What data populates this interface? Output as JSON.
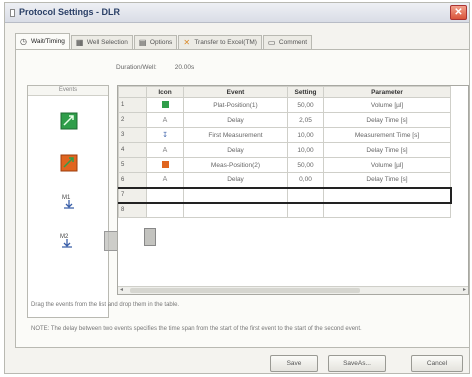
{
  "window": {
    "title": "Protocol Settings - DLR",
    "close_glyph": "✕"
  },
  "tabs": [
    {
      "label": "Wait/Timing",
      "icon": "clock-icon"
    },
    {
      "label": "Well Selection",
      "icon": "plate-icon"
    },
    {
      "label": "Options",
      "icon": "options-icon"
    },
    {
      "label": "Transfer to Excel(TM)",
      "icon": "excel-icon"
    },
    {
      "label": "Comment",
      "icon": "comment-icon"
    }
  ],
  "duration": {
    "label": "Duration/Well:",
    "value": "20.00s"
  },
  "palette": {
    "title": "Events",
    "items": [
      "move-position-green-icon",
      "move-position-orange-icon",
      "measurement-m1-icon",
      "measurement-m2-icon"
    ]
  },
  "grid": {
    "columns": [
      "Icon",
      "Event",
      "Setting",
      "Parameter"
    ],
    "rows": [
      {
        "num": "1",
        "icon": "green-square",
        "event": "Plat-Position(1)",
        "setting": "50,00",
        "parameter": "Volume [µl]"
      },
      {
        "num": "2",
        "icon": "delay-glyph",
        "event": "Delay",
        "setting": "2,05",
        "parameter": "Delay Time [s]"
      },
      {
        "num": "3",
        "icon": "measure-glyph",
        "event": "First Measurement",
        "setting": "10,00",
        "parameter": "Measurement Time [s]"
      },
      {
        "num": "4",
        "icon": "delay-glyph",
        "event": "Delay",
        "setting": "10,00",
        "parameter": "Delay Time [s]"
      },
      {
        "num": "5",
        "icon": "orange-square",
        "event": "Meas-Position(2)",
        "setting": "50,00",
        "parameter": "Volume [µl]"
      },
      {
        "num": "6",
        "icon": "delay-glyph",
        "event": "Delay",
        "setting": "0,00",
        "parameter": "Delay Time [s]"
      },
      {
        "num": "7",
        "icon": "",
        "event": "",
        "setting": "",
        "parameter": ""
      },
      {
        "num": "8",
        "icon": "",
        "event": "",
        "setting": "",
        "parameter": ""
      }
    ]
  },
  "hint": "Drag the events from the list and drop them in the table.",
  "note": "NOTE: The delay between two events specifies the time span from the start of the first event to the start of the second event.",
  "buttons": {
    "save": "Save",
    "save_as": "SaveAs...",
    "cancel": "Cancel"
  },
  "colors": {
    "green": "#2f9e4a",
    "orange": "#e0651f",
    "title": "#2a3f66",
    "close": "#d9543a"
  }
}
